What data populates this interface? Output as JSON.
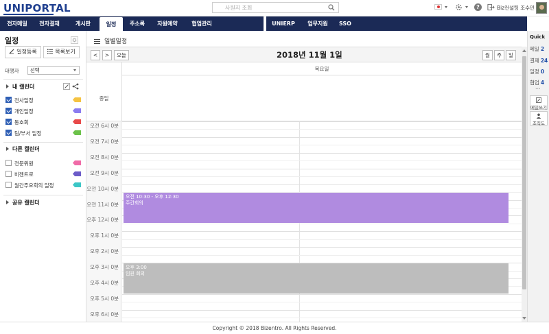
{
  "header": {
    "logo": "UNIPORTAL",
    "search_placeholder": "사원지 조회",
    "user_name": "Biz컨설팅 조수민"
  },
  "nav": {
    "items": [
      {
        "label": "전자메일"
      },
      {
        "label": "전자결재"
      },
      {
        "label": "게시판"
      },
      {
        "label": "일정"
      },
      {
        "label": "주소록"
      },
      {
        "label": "자원예약"
      },
      {
        "label": "협업관리"
      },
      {
        "label": "UNIERP"
      },
      {
        "label": "업무지원"
      },
      {
        "label": "SSO"
      }
    ],
    "active": "일정"
  },
  "quick": {
    "title": "Quick",
    "items": [
      {
        "label": "메일",
        "count": "2"
      },
      {
        "label": "결재",
        "count": "24"
      },
      {
        "label": "일정",
        "count": "0"
      },
      {
        "label": "협업",
        "count": "4"
      }
    ],
    "more": "···",
    "buttons": [
      {
        "label": "메일쓰기",
        "icon": "pencil-icon"
      },
      {
        "label": "조직도",
        "icon": "person-icon"
      }
    ]
  },
  "sidebar": {
    "title": "일정",
    "add_button": "일정등록",
    "list_button": "목록보기",
    "delegate_label": "대행자",
    "delegate_value": "선택",
    "my_calendar": {
      "title": "내 캘린더",
      "items": [
        {
          "name": "전사일정",
          "checked": true,
          "color": "#f5c342"
        },
        {
          "name": "개인일정",
          "checked": true,
          "color": "#8b7cf0"
        },
        {
          "name": "동호회",
          "checked": true,
          "color": "#e84a4a"
        },
        {
          "name": "팀/부서 일정",
          "checked": true,
          "color": "#6cc24a"
        }
      ]
    },
    "other_calendar": {
      "title": "다른 캘린더",
      "items": [
        {
          "name": "전문위원",
          "checked": false,
          "color": "#f06ba8"
        },
        {
          "name": "비젠트로",
          "checked": false,
          "color": "#6b5bc8"
        },
        {
          "name": "월간주요회의 일정",
          "checked": false,
          "color": "#3cc6c6"
        }
      ]
    },
    "shared_calendar": {
      "title": "공유 캘린더"
    }
  },
  "main": {
    "view_title": "일별일정",
    "prev": "<",
    "next": ">",
    "today": "오늘",
    "date": "2018년 11월 1일",
    "view_month": "월",
    "view_week": "주",
    "view_day": "일",
    "day_header": "목요일",
    "allday_label": "종일",
    "time_labels": [
      "오전 6시 0분",
      "오전 7시 0분",
      "오전 8시 0분",
      "오전 9시 0분",
      "오전 10시 0분",
      "오전 11시 0분",
      "오후 12시 0분",
      "오후 1시 0분",
      "오후 2시 0분",
      "오후 3시 0분",
      "오후 4시 0분",
      "오후 5시 0분",
      "오후 6시 0분"
    ],
    "events": [
      {
        "time": "오전 10:30 - 오후 12:30",
        "title": "주간회의",
        "color": "#b08be0",
        "start_hour": 10.5,
        "end_hour": 12.5
      },
      {
        "time": "오후 3:00",
        "title": "임원 회의",
        "color": "#bdbdbd",
        "start_hour": 15.0,
        "end_hour": 17.0
      }
    ]
  },
  "footer": {
    "copyright": "Copyright © 2018 Bizentro. All Rights Reserved."
  }
}
